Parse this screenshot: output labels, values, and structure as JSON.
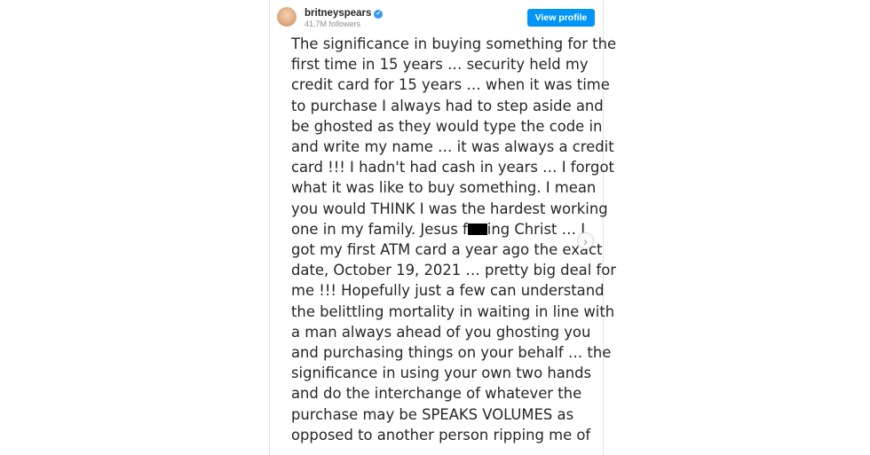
{
  "header": {
    "username": "britneyspears",
    "verified_glyph": "✓",
    "followers": "41.7M followers",
    "view_profile_label": "View profile"
  },
  "post": {
    "lines": [
      "The significance in buying something for the",
      "first time in 15 years … security held my",
      "credit card for 15 years … when it was time",
      "to purchase I always had to step aside and",
      "be ghosted as they would type the code in",
      "and write my name … it was always a credit",
      "card !!! I hadn't had cash in years … I forgot",
      "what it was like to buy something. I mean",
      "you would THINK I was the hardest working",
      "one in my family. Jesus f",
      "ing Christ … I",
      "got my first ATM card a year ago the exact",
      "date, October 19, 2021 … pretty big deal for",
      "me !!! Hopefully just a few can understand",
      "the belittling mortality in waiting in line with",
      "a man always ahead of you ghosting you",
      "and purchasing things on your behalf … the",
      "significance in using your own two hands",
      "and do the interchange of whatever the",
      "purchase may be SPEAKS VOLUMES as",
      "opposed to another person ripping me of"
    ]
  },
  "icons": {
    "next_arrow": "›"
  },
  "colors": {
    "accent": "#0095f6",
    "verified": "#3897f0",
    "text": "#262626",
    "muted": "#8e8e8e",
    "censor_bar": "#000000"
  }
}
